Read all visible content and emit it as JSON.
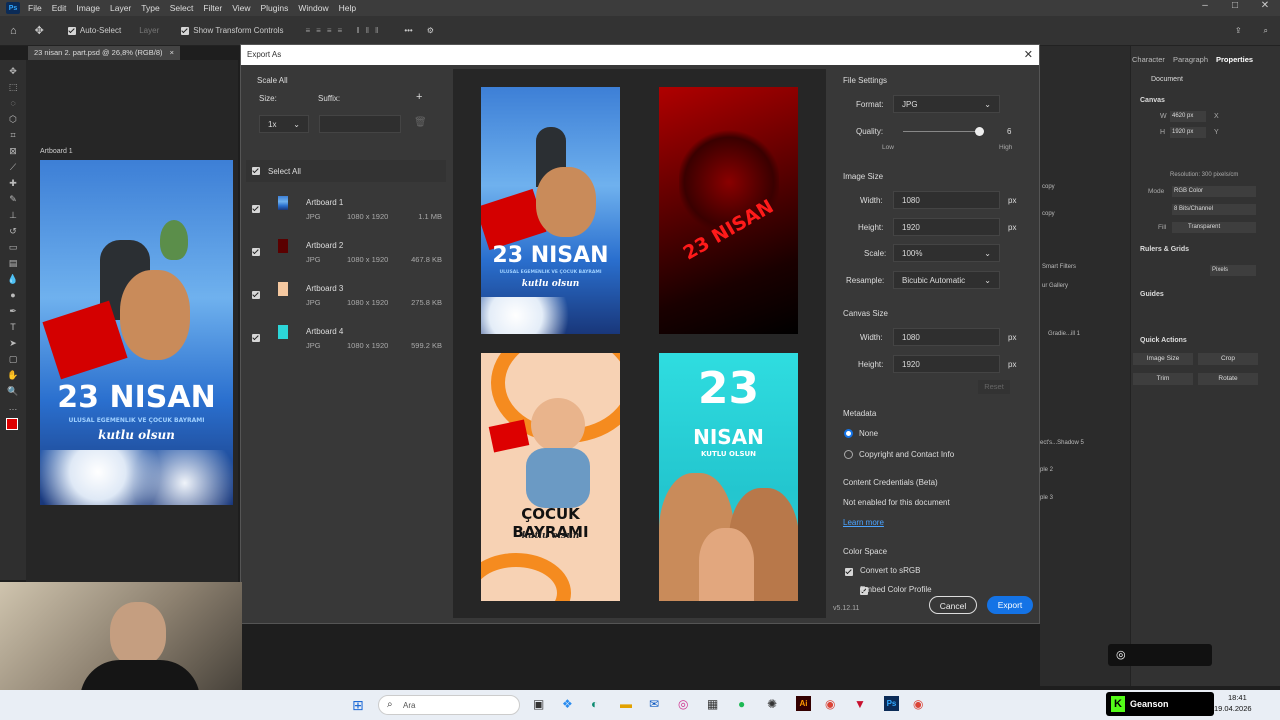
{
  "app": {
    "menu": [
      "File",
      "Edit",
      "Image",
      "Layer",
      "Type",
      "Select",
      "Filter",
      "View",
      "Plugins",
      "Window",
      "Help"
    ],
    "doc_tab": "23 nisan 2. part.psd @ 26,8% (RGB/8)",
    "artboard_label": "Artboard 1",
    "options": {
      "auto_select": "Auto-Select",
      "layer": "Layer",
      "show_transform": "Show Transform Controls"
    }
  },
  "dialog": {
    "title": "Export As",
    "scale_all": "Scale All",
    "size_label": "Size:",
    "suffix_label": "Suffix:",
    "scale_value": "1x",
    "select_all": "Select All",
    "artboards": [
      {
        "name": "Artboard 1",
        "format": "JPG",
        "dims": "1080 x 1920",
        "size": "1.1 MB"
      },
      {
        "name": "Artboard 2",
        "format": "JPG",
        "dims": "1080 x 1920",
        "size": "467.8 KB"
      },
      {
        "name": "Artboard 3",
        "format": "JPG",
        "dims": "1080 x 1920",
        "size": "275.8 KB"
      },
      {
        "name": "Artboard 4",
        "format": "JPG",
        "dims": "1080 x 1920",
        "size": "599.2 KB"
      }
    ],
    "previews": {
      "p1_title": "23 NISAN",
      "p1_sub": "ULUSAL EGEMENLIK VE ÇOCUK BAYRAMI",
      "p1_script": "kutlu olsun",
      "p2_title": "23 NISAN",
      "p3_title": "ÇOCUK BAYRAMI",
      "p3_script": "kutlu olsun",
      "p4_num": "23",
      "p4_title": "NISAN",
      "p4_sub": "KUTLU OLSUN"
    },
    "file_settings": {
      "heading": "File Settings",
      "format_label": "Format:",
      "format_value": "JPG",
      "quality_label": "Quality:",
      "quality_value": "6",
      "quality_low": "Low",
      "quality_high": "High"
    },
    "image_size": {
      "heading": "Image Size",
      "width_label": "Width:",
      "width_value": "1080",
      "height_label": "Height:",
      "height_value": "1920",
      "scale_label": "Scale:",
      "scale_value": "100%",
      "resample_label": "Resample:",
      "resample_value": "Bicubic Automatic",
      "unit": "px"
    },
    "canvas_size": {
      "heading": "Canvas Size",
      "width_label": "Width:",
      "width_value": "1080",
      "height_label": "Height:",
      "height_value": "1920",
      "unit": "px",
      "reset": "Reset"
    },
    "metadata": {
      "heading": "Metadata",
      "none": "None",
      "copyright": "Copyright and Contact Info"
    },
    "credentials": {
      "heading": "Content Credentials (Beta)",
      "text": "Not enabled for this document",
      "link": "Learn more"
    },
    "color_space": {
      "heading": "Color Space",
      "srgb": "Convert to sRGB",
      "embed": "Embed Color Profile"
    },
    "version": "v5.12.11",
    "cancel": "Cancel",
    "export": "Export"
  },
  "properties": {
    "tabs": [
      "Character",
      "Paragraph",
      "Properties"
    ],
    "document": "Document",
    "canvas_heading": "Canvas",
    "w_label": "W",
    "w_value": "4620 px",
    "h_label": "H",
    "h_value": "1920 px",
    "x_label": "X",
    "y_label": "Y",
    "resolution": "Resolution: 300 pixels/cm",
    "mode_label": "Mode",
    "mode_value": "RGB Color",
    "bits_value": "8 Bits/Channel",
    "fill_label": "Fill",
    "fill_value": "Transparent",
    "rulers_heading": "Rulers & Grids",
    "rulers_unit": "Pixels",
    "guides_heading": "Guides",
    "quick_heading": "Quick Actions",
    "quick": [
      "Image Size",
      "Crop",
      "Trim",
      "Rotate"
    ]
  },
  "layers": [
    "copy",
    "copy",
    "Smart Filters",
    "ur Gallery",
    "Gradie...ill 1",
    "ect's...Shadow 5",
    "ple 2",
    "ple 3"
  ],
  "taskbar": {
    "search": "Ara",
    "time": "18:41",
    "date": "19.04.2026"
  },
  "watermark": "Geanson",
  "colors": {
    "accent": "#1473e6",
    "red": "#d00"
  }
}
